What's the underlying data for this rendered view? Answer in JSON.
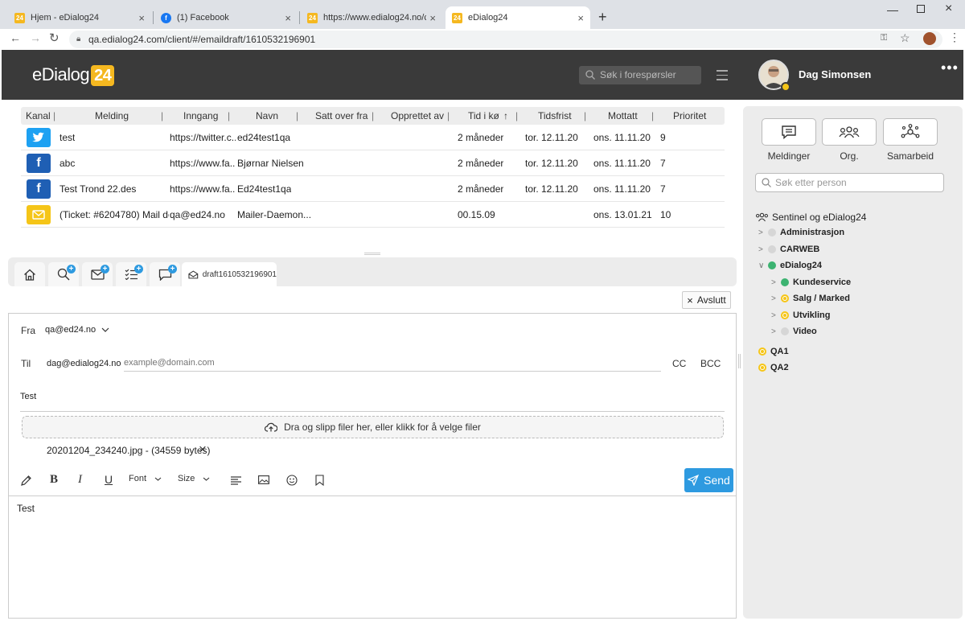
{
  "browser": {
    "tabs": [
      {
        "title": "Hjem - eDialog24",
        "favicon": "24"
      },
      {
        "title": "(1) Facebook",
        "favicon": "f"
      },
      {
        "title": "https://www.edialog24.no/chatwi",
        "favicon": "24"
      },
      {
        "title": "eDialog24",
        "favicon": "24"
      }
    ],
    "url": "qa.edialog24.com/client/#/emaildraft/1610532196901"
  },
  "header": {
    "logo_text": "eDialog",
    "logo_badge": "24",
    "search_placeholder": "Søk i forespørsler",
    "user_name": "Dag Simonsen",
    "more_glyph": "•••"
  },
  "table": {
    "headers": [
      "Kanal",
      "Melding",
      "Inngang",
      "Navn",
      "Satt over fra",
      "Opprettet av",
      "Tid i kø",
      "Tidsfrist",
      "Mottatt",
      "Prioritet"
    ],
    "sort_indicator": "↑",
    "rows": [
      {
        "channel": "twitter",
        "melding": "test",
        "inngang": "https://twitter.c...",
        "navn": "ed24test1qa",
        "satt_over": "",
        "opprettet": "",
        "tid": "2 måneder",
        "tidsfrist": "tor. 12.11.20",
        "mottatt": "ons. 11.11.20",
        "prioritet": "9"
      },
      {
        "channel": "facebook",
        "melding": "abc",
        "inngang": "https://www.fa...",
        "navn": "Bjørnar Nielsen",
        "satt_over": "",
        "opprettet": "",
        "tid": "2 måneder",
        "tidsfrist": "tor. 12.11.20",
        "mottatt": "ons. 11.11.20",
        "prioritet": "7"
      },
      {
        "channel": "facebook",
        "melding": "Test Trond 22.des",
        "inngang": "https://www.fa...",
        "navn": "Ed24test1qa",
        "satt_over": "",
        "opprettet": "",
        "tid": "2 måneder",
        "tidsfrist": "tor. 12.11.20",
        "mottatt": "ons. 11.11.20",
        "prioritet": "7"
      },
      {
        "channel": "email",
        "melding": "(Ticket: #6204780) Mail de...",
        "inngang": "qa@ed24.no",
        "navn": "Mailer-Daemon...",
        "satt_over": "",
        "opprettet": "",
        "tid": "00.15.09",
        "tidsfrist": "",
        "mottatt": "ons. 13.01.21",
        "prioritet": "10"
      }
    ]
  },
  "tabs_strip": {
    "draft_label": "draft1610532196901",
    "close_label": "Avslutt"
  },
  "email": {
    "from_label": "Fra",
    "from_value": "qa@ed24.no",
    "to_label": "Til",
    "to_value": "dag@edialog24.no",
    "to_placeholder": "example@domain.com",
    "cc_label": "CC",
    "bcc_label": "BCC",
    "subject": "Test",
    "drop_text": "Dra og slipp filer her, eller klikk for å velge filer",
    "attachment": "20201204_234240.jpg - (34559 bytes)",
    "font_label": "Font",
    "size_label": "Size",
    "send_label": "Send",
    "body": "Test"
  },
  "right_panel": {
    "buttons": [
      "Meldinger",
      "Org.",
      "Samarbeid"
    ],
    "search_placeholder": "Søk etter person",
    "org_title": "Sentinel og eDialog24",
    "tree": [
      {
        "label": "Administrasjon",
        "status": "offline",
        "level": 0,
        "expanded": false
      },
      {
        "label": "CARWEB",
        "status": "offline",
        "level": 0,
        "expanded": false
      },
      {
        "label": "eDialog24",
        "status": "online",
        "level": 0,
        "expanded": true
      },
      {
        "label": "Kundeservice",
        "status": "online",
        "level": 1,
        "expanded": false
      },
      {
        "label": "Salg / Marked",
        "status": "away",
        "level": 1,
        "expanded": false
      },
      {
        "label": "Utvikling",
        "status": "away",
        "level": 1,
        "expanded": false
      },
      {
        "label": "Video",
        "status": "offline",
        "level": 1,
        "expanded": false
      }
    ],
    "queues": [
      "QA1",
      "QA2"
    ]
  },
  "colors": {
    "accent": "#2e9ae0",
    "brand": "#f5b820",
    "header_bg": "#3a3a3a",
    "online": "#3cb371",
    "away": "#f5c518"
  }
}
